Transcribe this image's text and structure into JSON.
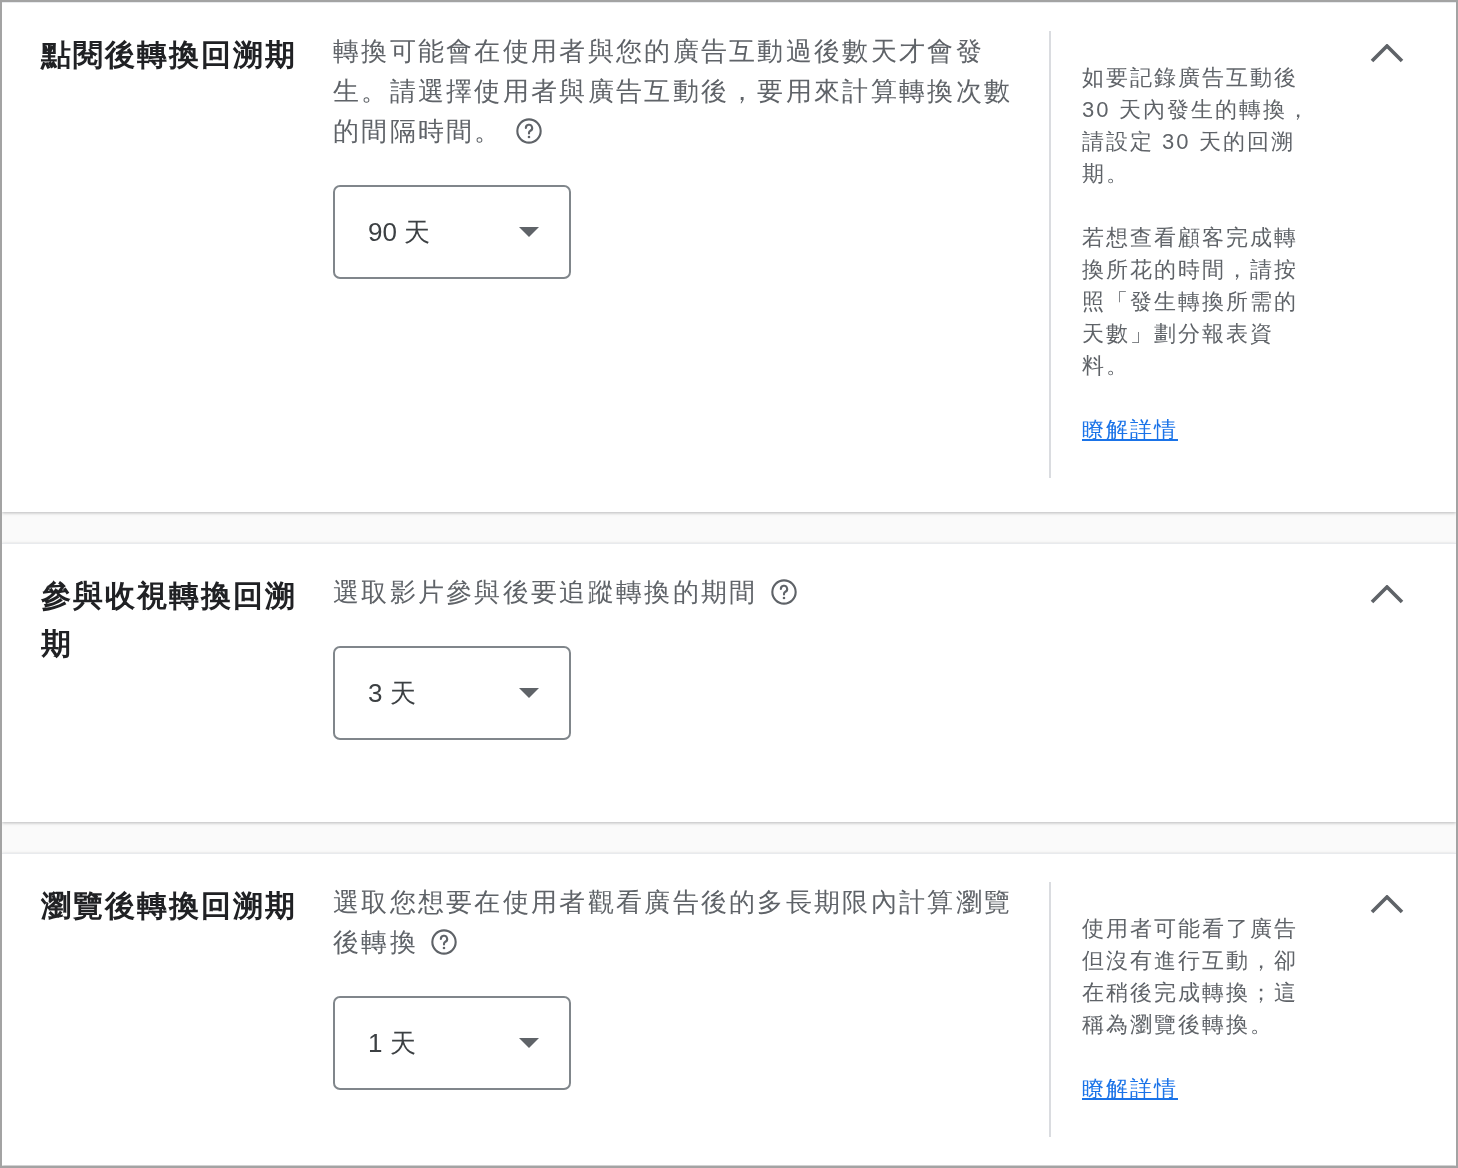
{
  "sections": [
    {
      "title": "點閱後轉換回溯期",
      "description": "轉換可能會在使用者與您的廣告互動過後數天才會發生。請選擇使用者與廣告互動後，要用來計算轉換次數的間隔時間。",
      "dropdown": {
        "value": "90 天"
      },
      "expanded": true,
      "aside": {
        "paragraphs": [
          "如要記錄廣告互動後 30 天內發生的轉換，請設定 30 天的回溯期。",
          "若想查看顧客完成轉換所花的時間，請按照「發生轉換所需的天數」劃分報表資料。"
        ],
        "link": "瞭解詳情"
      }
    },
    {
      "title": "參與收視轉換回溯期",
      "description": "選取影片參與後要追蹤轉換的期間",
      "dropdown": {
        "value": "3 天"
      },
      "expanded": true
    },
    {
      "title": "瀏覽後轉換回溯期",
      "description": "選取您想要在使用者觀看廣告後的多長期限內計算瀏覽後轉換",
      "dropdown": {
        "value": "1 天"
      },
      "expanded": true,
      "aside": {
        "paragraphs": [
          "使用者可能看了廣告但沒有進行互動，卻在稍後完成轉換；這稱為瀏覽後轉換。"
        ],
        "link": "瞭解詳情"
      }
    }
  ]
}
